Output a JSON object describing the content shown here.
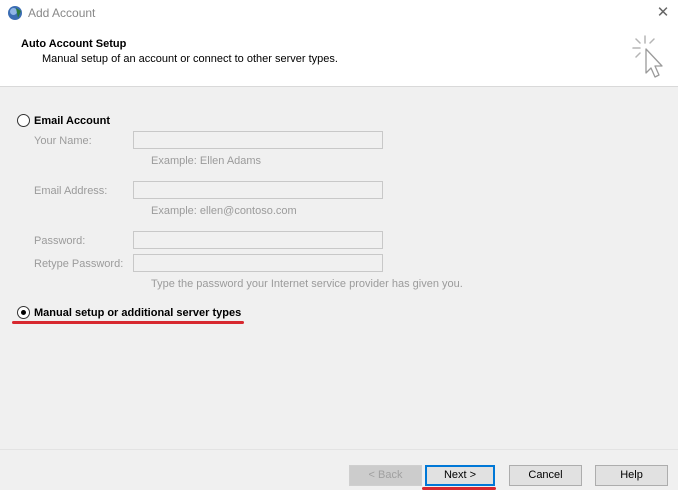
{
  "window": {
    "title": "Add Account",
    "close_glyph": "✕"
  },
  "header": {
    "title": "Auto Account Setup",
    "subtitle": "Manual setup of an account or connect to other server types."
  },
  "options": {
    "email_account": "Email Account",
    "manual_setup": "Manual setup or additional server types",
    "selected": "manual_setup"
  },
  "form": {
    "name_label": "Your Name:",
    "name_value": "",
    "name_hint": "Example: Ellen Adams",
    "email_label": "Email Address:",
    "email_value": "",
    "email_hint": "Example: ellen@contoso.com",
    "password_label": "Password:",
    "password_value": "",
    "retype_label": "Retype Password:",
    "retype_value": "",
    "password_hint": "Type the password your Internet service provider has given you."
  },
  "buttons": {
    "back": "< Back",
    "next": "Next >",
    "cancel": "Cancel",
    "help": "Help"
  },
  "colors": {
    "annotation_underline": "#d7282f",
    "focus_border": "#0078d7"
  },
  "icons": {
    "app": "outlook-app-icon",
    "wizard": "click-sparkle-cursor-icon"
  }
}
